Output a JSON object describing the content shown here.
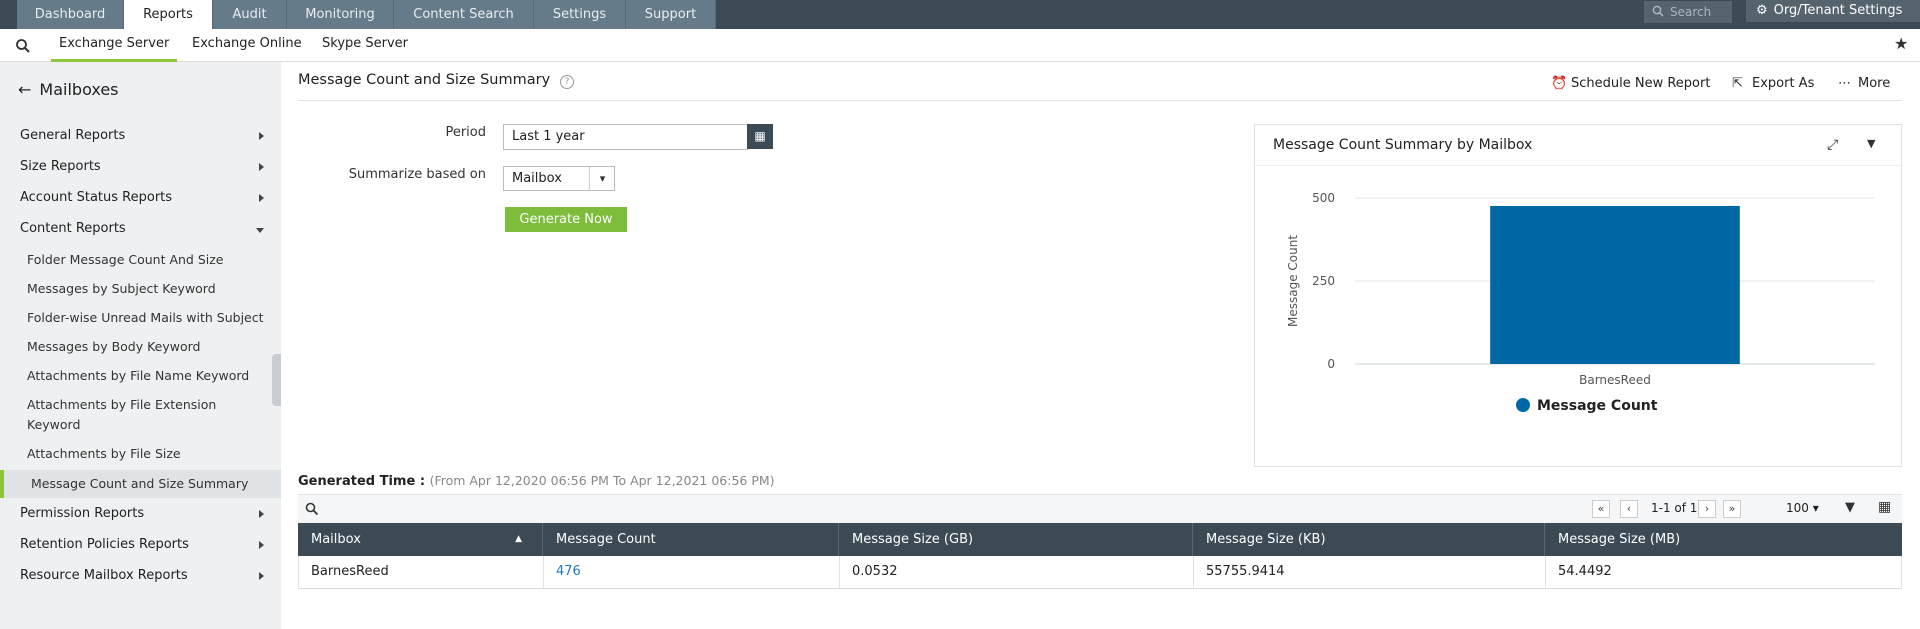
{
  "top_nav": {
    "tabs": [
      {
        "label": "Dashboard"
      },
      {
        "label": "Reports"
      },
      {
        "label": "Audit"
      },
      {
        "label": "Monitoring"
      },
      {
        "label": "Content Search"
      },
      {
        "label": "Settings"
      },
      {
        "label": "Support"
      }
    ],
    "active_tab": "Reports",
    "search_placeholder": "Search",
    "org_settings_label": "Org/Tenant Settings"
  },
  "sub_nav": {
    "tabs": [
      {
        "label": "Exchange Server"
      },
      {
        "label": "Exchange Online"
      },
      {
        "label": "Skype Server"
      }
    ],
    "active_tab": "Exchange Server"
  },
  "sidebar": {
    "title": "Mailboxes",
    "groups": [
      {
        "label": "General Reports"
      },
      {
        "label": "Size Reports"
      },
      {
        "label": "Account Status Reports"
      },
      {
        "label": "Content Reports"
      },
      {
        "label": "Permission Reports"
      },
      {
        "label": "Retention Policies Reports"
      },
      {
        "label": "Resource Mailbox Reports"
      }
    ],
    "content_items": [
      {
        "label": "Folder Message Count And Size"
      },
      {
        "label": "Messages by Subject Keyword"
      },
      {
        "label": "Folder-wise Unread Mails with Subject"
      },
      {
        "label": "Messages by Body Keyword"
      },
      {
        "label": "Attachments by File Name Keyword"
      },
      {
        "label": "Attachments by File Extension Keyword"
      },
      {
        "label": "Attachments by File Size"
      },
      {
        "label": "Message Count and Size Summary"
      }
    ],
    "active_item": "Message Count and Size Summary"
  },
  "page": {
    "title": "Message Count and Size Summary",
    "actions": {
      "schedule": "Schedule New Report",
      "export": "Export As",
      "more": "More"
    }
  },
  "form": {
    "period_label": "Period",
    "period_value": "Last 1 year",
    "summarize_label": "Summarize based on",
    "summarize_value": "Mailbox",
    "generate_label": "Generate Now"
  },
  "chart": {
    "title": "Message Count Summary by Mailbox",
    "ylabel": "Message Count",
    "legend": "Message Count",
    "ticks": [
      "500",
      "250",
      "0"
    ],
    "bar_color": "#0067a5"
  },
  "chart_data": {
    "type": "bar",
    "categories": [
      "BarnesReed"
    ],
    "series": [
      {
        "name": "Message Count",
        "values": [
          476
        ]
      }
    ],
    "ylabel": "Message Count",
    "ylim": [
      0,
      500
    ],
    "yticks": [
      0,
      250,
      500
    ],
    "grid": true,
    "legend_position": "bottom"
  },
  "generated": {
    "label": "Generated Time :",
    "range": "(From Apr 12,2020 06:56 PM To Apr 12,2021 06:56 PM)"
  },
  "pagination": {
    "range": "1-1 of 1",
    "page_size": "100"
  },
  "table": {
    "headers": [
      "Mailbox",
      "Message Count",
      "Message Size (GB)",
      "Message Size (KB)",
      "Message Size (MB)"
    ],
    "rows": [
      [
        "BarnesReed",
        "476",
        "0.0532",
        "55755.9414",
        "54.4492"
      ]
    ]
  }
}
